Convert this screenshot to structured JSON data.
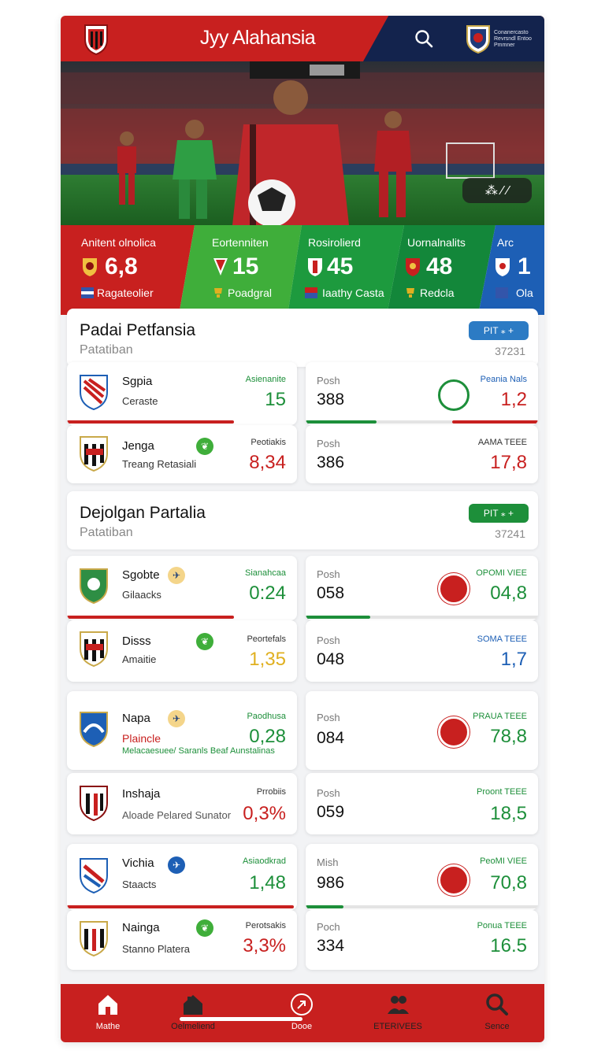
{
  "header": {
    "title": "Jyy Alahansia",
    "partner_text": "Conanercasto Revrsndl Entoo Pmmner",
    "colors": {
      "red": "#c8201f",
      "navy": "#13234d"
    },
    "icons": [
      "club-crest-icon",
      "search-icon",
      "partner-crest-icon"
    ]
  },
  "hero": {
    "controls": "⁂ ⁄ ⁄"
  },
  "stats": [
    {
      "label": "Anitent olnolica",
      "value": "6,8",
      "sub": "Ragateolier",
      "color": "#c8201f"
    },
    {
      "label": "Eortenniten",
      "value": "15",
      "sub": "Poadgral",
      "color": "#3fae3a"
    },
    {
      "label": "Rosirolierd",
      "value": "45",
      "sub": "Iaathy Casta",
      "color": "#1d9a3e"
    },
    {
      "label": "Uornalnalits",
      "value": "48",
      "sub": "Redcla",
      "color": "#13873a"
    },
    {
      "label": "Arc",
      "value": "1",
      "sub": "Ola",
      "color": "#1d5fb5"
    }
  ],
  "sections": [
    {
      "title": "Padai Petfansia",
      "subtitle": "Patatiban",
      "pill": "PIT ⁎ +",
      "code": "37231",
      "pill_color": "#2c7bc4"
    },
    {
      "title": "Dejolgan Partalia",
      "subtitle": "Patatiban",
      "pill": "PIT ⁎ +",
      "code": "37241",
      "pill_color": "#1d8f3a"
    }
  ],
  "matches": [
    {
      "team": "Sgpia",
      "team_sub": "Ceraste",
      "stat_label": "Asienanite",
      "stat_value": "15",
      "stat_color": "green",
      "pos_label": "Posh",
      "pos_value": "388",
      "right_label": "Peania Nals",
      "right_value": "1,2",
      "right_label_color": "blue",
      "right_value_color": "red"
    },
    {
      "team": "Jenga",
      "team_sub": "Treang Retasiali",
      "stat_label": "Peotiakis",
      "stat_value": "8,34",
      "stat_color": "red",
      "pos_label": "Posh",
      "pos_value": "386",
      "right_label": "AAMA TEEE",
      "right_value": "17,8",
      "right_label_color": "dark",
      "right_value_color": "red"
    },
    {
      "team": "Sgobte",
      "team_sub": "Gilaacks",
      "stat_label": "Sianahcaa",
      "stat_value": "0:24",
      "stat_color": "green",
      "pos_label": "Posh",
      "pos_value": "058",
      "right_label": "OPOMI VIEE",
      "right_value": "04,8",
      "right_label_color": "green",
      "right_value_color": "green"
    },
    {
      "team": "Disss",
      "team_sub": "Amaitie",
      "stat_label": "Peortefals",
      "stat_value": "1,35",
      "stat_color": "gold",
      "pos_label": "Posh",
      "pos_value": "048",
      "right_label": "SOMA TEEE",
      "right_value": "1,7",
      "right_label_color": "blue",
      "right_value_color": "blue"
    },
    {
      "team": "Napa",
      "team_sub": "Plaincle",
      "team_note": "Melacaesuee/ Saranls Beaf Aunstalinas",
      "stat_label": "Paodhusa",
      "stat_value": "0,28",
      "stat_color": "green",
      "pos_label": "Posh",
      "pos_value": "084",
      "right_label": "PRAUA TEEE",
      "right_value": "78,8",
      "right_label_color": "green",
      "right_value_color": "green"
    },
    {
      "team": "Inshaja",
      "team_sub": "Aloade Pelared Sunator",
      "stat_label": "Prrobiis",
      "stat_value": "0,3%",
      "stat_color": "red",
      "pos_label": "Posh",
      "pos_value": "059",
      "right_label": "Proont TEEE",
      "right_value": "18,5",
      "right_label_color": "green",
      "right_value_color": "green"
    },
    {
      "team": "Vichia",
      "team_sub": "Staacts",
      "stat_label": "Asiaodkrad",
      "stat_value": "1,48",
      "stat_color": "green",
      "pos_label": "Mish",
      "pos_value": "986",
      "right_label": "PeoMI VIEE",
      "right_value": "70,8",
      "right_label_color": "green",
      "right_value_color": "green"
    },
    {
      "team": "Nainga",
      "team_sub": "Stanno Platera",
      "stat_label": "Perotsakis",
      "stat_value": "3,3%",
      "stat_color": "red",
      "pos_label": "Poch",
      "pos_value": "334",
      "right_label": "Ponua TEEE",
      "right_value": "16.5",
      "right_label_color": "green",
      "right_value_color": "green"
    }
  ],
  "bottom_nav": [
    {
      "label": "Mathe",
      "icon": "home-icon"
    },
    {
      "label": "Oelmeliend",
      "icon": "house-icon"
    },
    {
      "label": "Dooe",
      "icon": "compass-icon"
    },
    {
      "label": "ETERIVEES",
      "icon": "players-icon"
    },
    {
      "label": "Sence",
      "icon": "search-icon"
    }
  ]
}
